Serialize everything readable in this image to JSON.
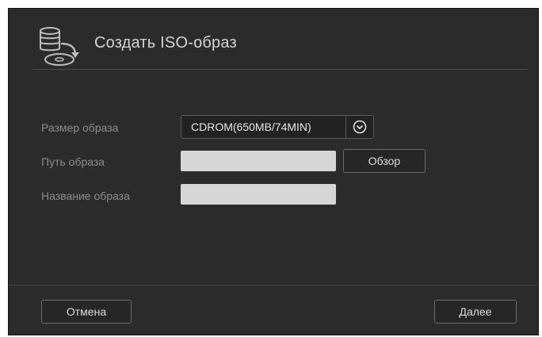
{
  "dialog": {
    "title": "Создать ISO-образ",
    "icon": "disc-image-icon"
  },
  "form": {
    "size_label": "Размер образа",
    "size_value": "CDROM(650MB/74MIN)",
    "path_label": "Путь образа",
    "path_value": "",
    "name_label": "Название образа",
    "name_value": ""
  },
  "buttons": {
    "browse": "Обзор",
    "cancel": "Отмена",
    "next": "Далее"
  },
  "colors": {
    "background": "#2b2b2b",
    "input": "#d6d6d6",
    "text": "#d4d4d4",
    "label": "#8c8c8c"
  }
}
